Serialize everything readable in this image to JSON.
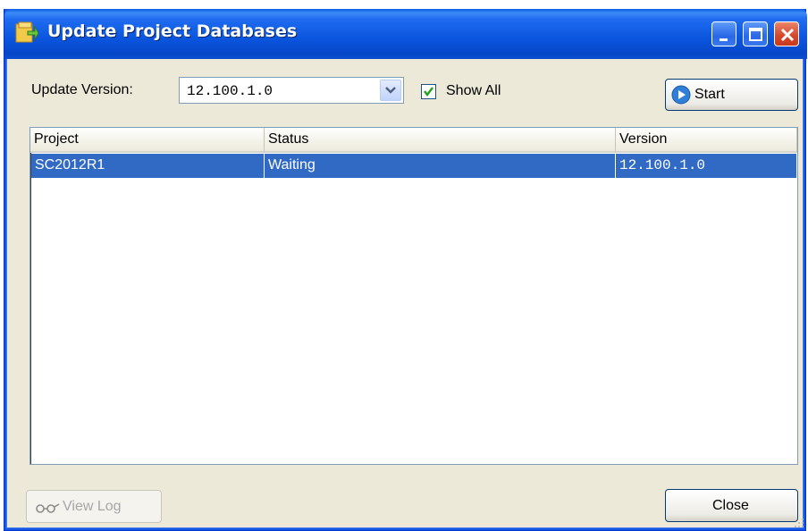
{
  "window": {
    "title": "Update Project Databases"
  },
  "toolbar": {
    "version_label": "Update Version:",
    "version_value": "12.100.1.0",
    "show_all_label": "Show All",
    "show_all_checked": true,
    "start_label": "Start"
  },
  "table": {
    "columns": [
      "Project",
      "Status",
      "Version"
    ],
    "rows": [
      {
        "project": "SC2012R1",
        "status": "Waiting",
        "version": "12.100.1.0",
        "selected": true
      }
    ]
  },
  "footer": {
    "view_log_label": "View Log",
    "view_log_enabled": false,
    "close_label": "Close"
  },
  "colors": {
    "titlebar": "#0a55dd",
    "selection": "#316ac5",
    "dialog_bg": "#ece9d8"
  },
  "icons": {
    "title": "update-database-icon",
    "start": "play-icon",
    "view_log": "glasses-icon"
  }
}
